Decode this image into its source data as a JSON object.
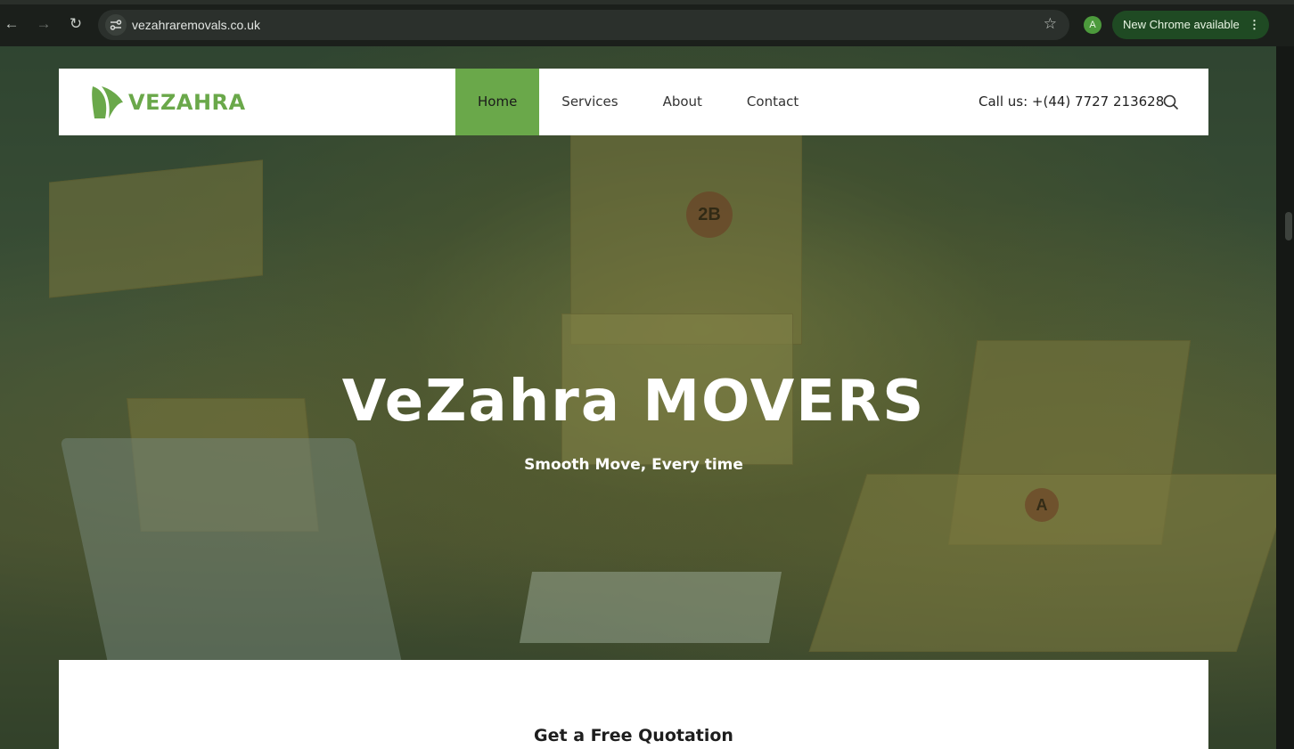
{
  "browser": {
    "url": "vezahraremovals.co.uk",
    "profile_initial": "A",
    "update_label": "New Chrome available",
    "icons": {
      "back": "arrow-left-icon",
      "forward": "arrow-right-icon",
      "reload": "reload-icon",
      "site_info": "tune-icon",
      "bookmark": "star-icon",
      "menu": "kebab-icon"
    }
  },
  "header": {
    "logo_text": "VEZAHRA",
    "nav": [
      {
        "label": "Home",
        "active": true
      },
      {
        "label": "Services",
        "active": false
      },
      {
        "label": "About",
        "active": false
      },
      {
        "label": "Contact",
        "active": false
      }
    ],
    "call_us": "Call us: +(44) 7727 213628",
    "search_icon": "search-icon"
  },
  "hero": {
    "title": "VeZahra MOVERS",
    "subtitle": "Smooth Move, Every time",
    "box_labels": [
      "2B",
      "A"
    ]
  },
  "quote": {
    "title": "Get a Free Quotation"
  },
  "colors": {
    "brand_green": "#6aa84a",
    "chrome_update_pill": "#1f4a23"
  }
}
